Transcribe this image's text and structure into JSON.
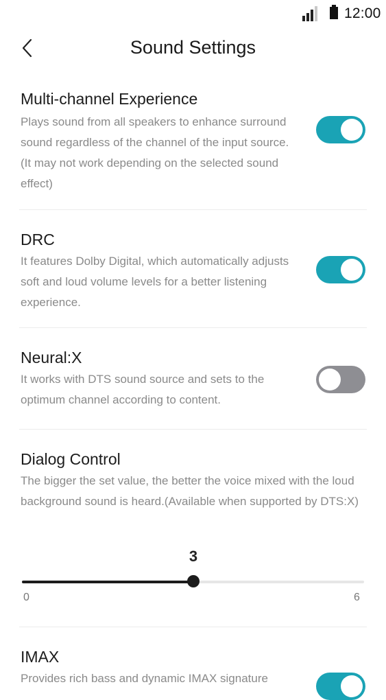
{
  "status_bar": {
    "time": "12:00",
    "signal_icon": "signal-icon",
    "battery_icon": "battery-icon"
  },
  "header": {
    "title": "Sound Settings",
    "back_icon": "chevron-left-icon"
  },
  "accent_color": "#1aa3b5",
  "off_color": "#8e8e93",
  "settings": [
    {
      "title": "Multi-channel Experience",
      "description": "Plays sound from all speakers to enhance surround sound regardless of the channel of the input source. (It may not work depending on the selected sound effect)",
      "enabled": true
    },
    {
      "title": "DRC",
      "description": "It features Dolby Digital, which automatically adjusts soft and loud volume levels for a better listening experience.",
      "enabled": true
    },
    {
      "title": "Neural:X",
      "description": "It works with DTS sound source and sets to the optimum channel according to content.",
      "enabled": false
    }
  ],
  "dialog_control": {
    "title": "Dialog Control",
    "description": "The bigger the set value, the better the voice mixed with the loud background sound is heard.(Available when supported by DTS:X)",
    "value": "3",
    "min": "0",
    "max": "6"
  },
  "imax": {
    "title": "IMAX",
    "description": "Provides rich bass and dynamic IMAX signature",
    "enabled": true
  }
}
